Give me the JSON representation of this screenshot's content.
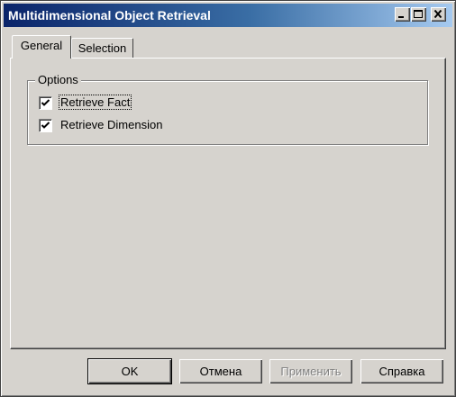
{
  "window": {
    "title": "Multidimensional Object Retrieval"
  },
  "tabs": [
    {
      "label": "General",
      "active": true
    },
    {
      "label": "Selection",
      "active": false
    }
  ],
  "options": {
    "group_label": "Options",
    "items": [
      {
        "label": "Retrieve Fact",
        "checked": true
      },
      {
        "label": "Retrieve Dimension",
        "checked": true
      }
    ]
  },
  "buttons": {
    "ok": "OK",
    "cancel": "Отмена",
    "apply": "Применить",
    "help": "Справка"
  },
  "colors": {
    "face": "#d6d3ce",
    "title_start": "#0a246a",
    "title_end": "#a6caf0"
  }
}
